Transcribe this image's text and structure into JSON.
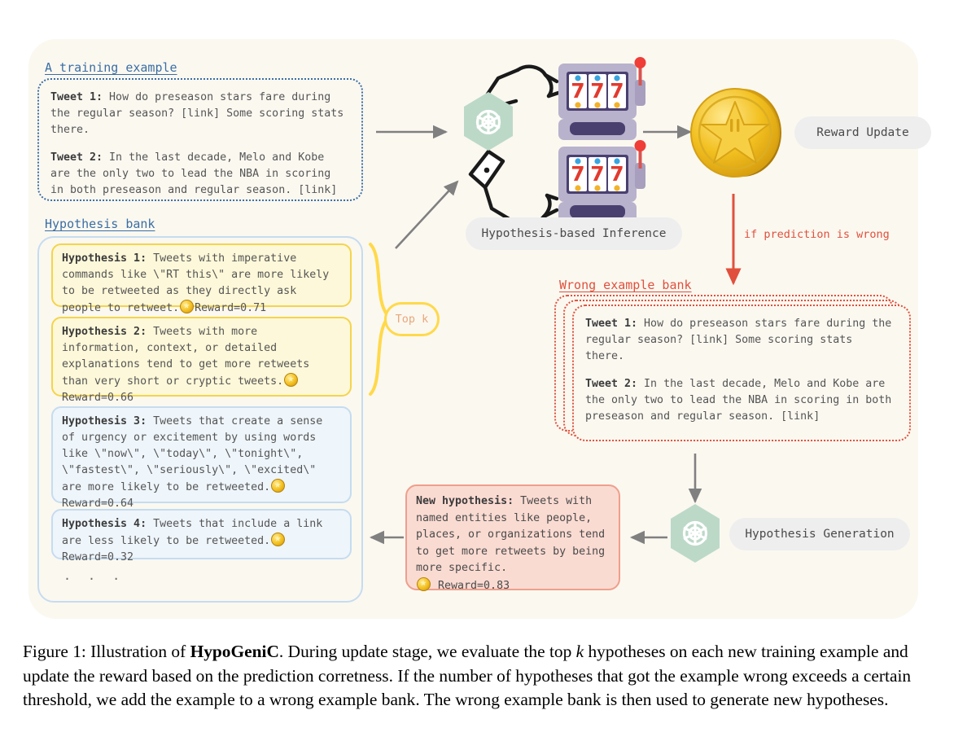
{
  "figure": {
    "caption_prefix": "Figure 1: Illustration of ",
    "caption_bold": "HypoGeniC",
    "caption_rest_1": ". During update stage, we evaluate the top ",
    "caption_italic": "k",
    "caption_rest_2": " hypotheses on each new training example and update the reward based on the prediction corretness. If the number of hypotheses that got the example wrong exceeds a certain threshold, we add the example to a wrong example bank. The wrong example bank is then used to generate new hypotheses."
  },
  "training_example": {
    "heading": "A training example",
    "tweet1_label": "Tweet 1:",
    "tweet1_text": " How do preseason stars fare during the regular season? [link] Some scoring stats there.",
    "tweet2_label": "Tweet 2:",
    "tweet2_text": " In the last decade, Melo and Kobe are the only two to lead the NBA in scoring in both preseason and regular season. [link]"
  },
  "hypothesis_bank": {
    "heading": "Hypothesis bank",
    "topk_label": "Top k",
    "ellipsis": ". . .",
    "items": [
      {
        "label": "Hypothesis 1:",
        "text": " Tweets with imperative commands like \\\"RT this\\\" are more likely to be retweeted as they directly ask people to retweet.",
        "reward": "Reward=0.71",
        "color": "yellow"
      },
      {
        "label": "Hypothesis 2:",
        "text": " Tweets with more information, context, or detailed explanations tend to get more retweets than very short or cryptic tweets.",
        "reward": "Reward=0.66",
        "color": "yellow"
      },
      {
        "label": "Hypothesis 3:",
        "text": " Tweets that create a sense of urgency or excitement by using words like \\\"now\\\", \\\"today\\\", \\\"tonight\\\", \\\"fastest\\\", \\\"seriously\\\", \\\"excited\\\" are more likely to be retweeted.",
        "reward": "Reward=0.64",
        "color": "blue"
      },
      {
        "label": "Hypothesis 4:",
        "text": " Tweets that include a link are less likely to be retweeted.",
        "reward": "Reward=0.32",
        "color": "blue"
      }
    ]
  },
  "inference": {
    "label": "Hypothesis-based Inference",
    "llm_icon": "openai-logo-icon",
    "slot_machine_symbol": "777"
  },
  "reward": {
    "label": "Reward Update",
    "coin_icon": "gold-star-coin-icon"
  },
  "wrong_example_bank": {
    "heading": "Wrong example bank",
    "condition_note": "if prediction is wrong",
    "tweet1_label": "Tweet 1:",
    "tweet1_text": " How do preseason stars fare during the regular season? [link] Some scoring stats there.",
    "tweet2_label": "Tweet 2:",
    "tweet2_text": " In the last decade, Melo and Kobe are the only two to lead the NBA in scoring in both preseason and regular season. [link]"
  },
  "generation": {
    "label": "Hypothesis Generation",
    "new_hypothesis_label": "New hypothesis:",
    "new_hypothesis_text": " Tweets with named entities like people, places, or organizations tend to get more retweets by being more specific.",
    "new_hypothesis_reward": "Reward=0.83"
  },
  "colors": {
    "panel_bg": "#fbf8f0",
    "blue_accent": "#3a6ea5",
    "red_accent": "#e0503c",
    "yellow_accent": "#f5d44a",
    "lightblue_accent": "#c5dcf0",
    "pink_accent": "#ef9f8c",
    "llm_hex_fill": "#bcd9c8",
    "arrow_gray": "#808080"
  }
}
